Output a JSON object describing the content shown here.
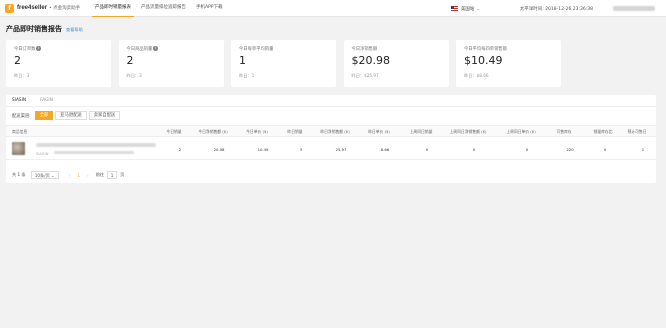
{
  "header": {
    "logo_mark": "f",
    "brand": "free4seller",
    "brand_sub": "• 点金淘卖助手",
    "nav": [
      "产品即时销量报表",
      "产品流量排位追踪报告",
      "手机APP下载"
    ],
    "region_label": "美国站",
    "region_caret": "⌄",
    "time_text": "太平洋时间: 2018-12-26 23:36:38"
  },
  "page": {
    "title": "产品即时销售报告",
    "help_link": "查看帮助"
  },
  "cards": [
    {
      "label": "今日订单数",
      "has_info": true,
      "value": "2",
      "sub": "昨日：3"
    },
    {
      "label": "今日商品销量",
      "has_info": true,
      "value": "2",
      "sub": "昨日：3"
    },
    {
      "label": "今日每单平均销量",
      "has_info": false,
      "value": "1",
      "sub": "昨日：1"
    },
    {
      "label": "今日净销售额",
      "has_info": false,
      "value": "$20.98",
      "sub": "昨日：$25.97"
    },
    {
      "label": "今日平均每四单销售额",
      "has_info": false,
      "value": "$10.49",
      "sub": "昨日：$8.66"
    }
  ],
  "site_tabs": [
    "SIASIN",
    "FAGIN"
  ],
  "filter": {
    "label": "配送渠道:",
    "options": [
      "全部",
      "亚马逊配送",
      "卖家自配送"
    ]
  },
  "table": {
    "headers": [
      "商品信息",
      "今日销量",
      "今日净销售额 ($)",
      "今日单价 ($)",
      "昨日销量",
      "昨日净销售额 ($)",
      "昨日单价 ($)",
      "上周同日销量",
      "上周同日净销售额 ($)",
      "上周同日单价 ($)",
      "可售库存",
      "销量库存比",
      "预计可售日"
    ],
    "rows": [
      {
        "sku": "SIASIN",
        "cells": [
          "2",
          "20.98",
          "10.49",
          "3",
          "25.97",
          "8.66",
          "0",
          "0",
          "0",
          "220",
          "0",
          "1"
        ]
      }
    ]
  },
  "pagination": {
    "total": "共 1 条",
    "page_size": "10条/页",
    "prev": "‹",
    "current_page": "1",
    "next": "›",
    "goto_label": "前往",
    "goto_value": "1",
    "goto_suffix": "页"
  }
}
